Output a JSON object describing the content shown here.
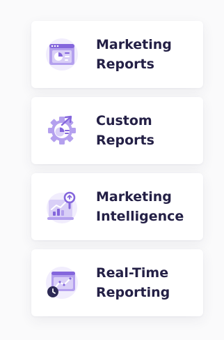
{
  "menu": {
    "items": [
      {
        "line1": "Marketing",
        "line2": "Reports",
        "icon": "report-dashboard-icon"
      },
      {
        "line1": "Custom",
        "line2": "Reports",
        "icon": "gear-chart-icon"
      },
      {
        "line1": "Marketing",
        "line2": "Intelligence",
        "icon": "magnifier-chart-icon"
      },
      {
        "line1": "Real-Time",
        "line2": "Reporting",
        "icon": "clock-chart-icon"
      }
    ]
  },
  "colors": {
    "text": "#242046",
    "icon_light": "#d9cff7",
    "icon_mid": "#b4a0ee",
    "icon_dark": "#8466dc",
    "card": "#ffffff",
    "background": "#fafafb"
  }
}
